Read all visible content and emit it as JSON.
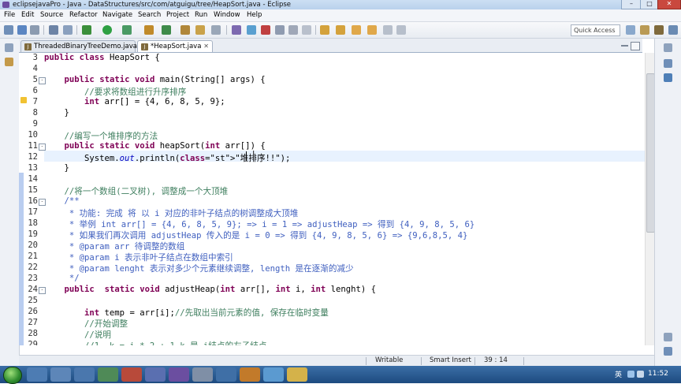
{
  "window": {
    "title": "eclipsejavaPro - Java - DataStructures/src/com/atguigu/tree/HeapSort.java - Eclipse"
  },
  "menu": [
    "File",
    "Edit",
    "Source",
    "Refactor",
    "Navigate",
    "Search",
    "Project",
    "Run",
    "Window",
    "Help"
  ],
  "toolbar": {
    "quick_access_placeholder": "Quick Access"
  },
  "tabs": [
    {
      "label": "ThreadedBinaryTreeDemo.java",
      "active": false
    },
    {
      "label": "*HeapSort.java",
      "active": true
    }
  ],
  "editor": {
    "line_numbers": [
      "3",
      "4",
      "5",
      "6",
      "7",
      "8",
      "9",
      "10",
      "11",
      "12",
      "13",
      "14",
      "15",
      "16",
      "17",
      "18",
      "19",
      "20",
      "21",
      "22",
      "23",
      "24",
      "25",
      "26",
      "27",
      "28",
      "29"
    ],
    "current_line": "12",
    "lines": [
      "public class HeapSort {",
      "",
      "    public static void main(String[] args) {",
      "        //要求将数组进行升序排序",
      "        int arr[] = {4, 6, 8, 5, 9};",
      "    }",
      "",
      "    //编写一个堆排序的方法",
      "    public static void heapSort(int arr[]) {",
      "        System.out.println(\"堆排序!!\");",
      "    }",
      "",
      "    //将一个数组(二叉树), 调整成一个大顶堆",
      "    /**",
      "     * 功能: 完成 将 以 i 对应的非叶子结点的树调整成大顶堆",
      "     * 举例 int arr[] = {4, 6, 8, 5, 9}; => i = 1 => adjustHeap => 得到 {4, 9, 8, 5, 6}",
      "     * 如果我们再次调用 adjustHeap 传入的是 i = 0 => 得到 {4, 9, 8, 5, 6} => {9,6,8,5, 4}",
      "     * @param arr 待调整的数组",
      "     * @param i 表示非叶子结点在数组中索引",
      "     * @param lenght 表示对多少个元素继续调整, length 是在逐渐的减少",
      "     */",
      "    public  static void adjustHeap(int arr[], int i, int lenght) {",
      "",
      "        int temp = arr[i];//先取出当前元素的值, 保存在临时变量",
      "        //开始调整",
      "        //说明",
      "        //1. k = i * 2 + 1 k 是 i结点的左子结点"
    ]
  },
  "status": {
    "writable": "Writable",
    "insert_mode": "Smart Insert",
    "position": "39 : 14"
  },
  "taskbar": {
    "ime": "英",
    "clock": "11:52"
  }
}
